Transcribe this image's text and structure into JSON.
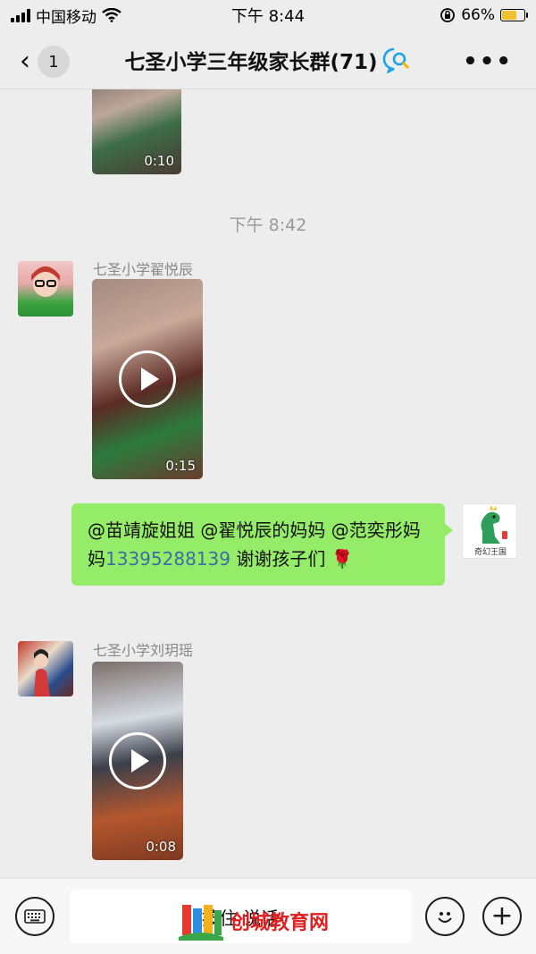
{
  "status_bar": {
    "carrier": "中国移动",
    "time": "下午 8:44",
    "battery_percent": "66%",
    "battery_level": 0.66,
    "icons": [
      "signal-icon",
      "wifi-icon",
      "lock-rotation-icon",
      "battery-icon"
    ]
  },
  "nav": {
    "back_icon": "chevron-left-icon",
    "unread_count": "1",
    "title": "七圣小学三年级家长群(71)",
    "title_icon": "chat-search-icon",
    "more_icon": "more-dots-icon"
  },
  "messages": [
    {
      "type": "video",
      "side": "left",
      "duration": "0:10"
    },
    {
      "type": "time",
      "text": "下午 8:42"
    },
    {
      "type": "video",
      "side": "left",
      "sender": "七圣小学翟悦辰",
      "duration": "0:15",
      "play_icon": "play-icon"
    },
    {
      "type": "text",
      "side": "right",
      "text_before": "@苗靖旋姐姐 @翟悦辰的妈妈 @范奕彤妈妈",
      "phone": "13395288139",
      "text_after": " 谢谢孩子们",
      "emoji": "🌹",
      "avatar_caption": "奇幻王国"
    },
    {
      "type": "video",
      "side": "left",
      "sender": "七圣小学刘玥瑶",
      "duration": "0:08",
      "play_icon": "play-icon"
    }
  ],
  "bottom_bar": {
    "keyboard_icon": "keyboard-icon",
    "voice_label": "按住 说话",
    "emoji_icon": "smile-icon",
    "add_icon": "plus-icon"
  },
  "watermark": {
    "text": "创城教育网"
  },
  "colors": {
    "background": "#ededed",
    "bubble_green": "#95ec69",
    "link_blue": "#3a6ea5",
    "watermark_red": "#e02020"
  }
}
